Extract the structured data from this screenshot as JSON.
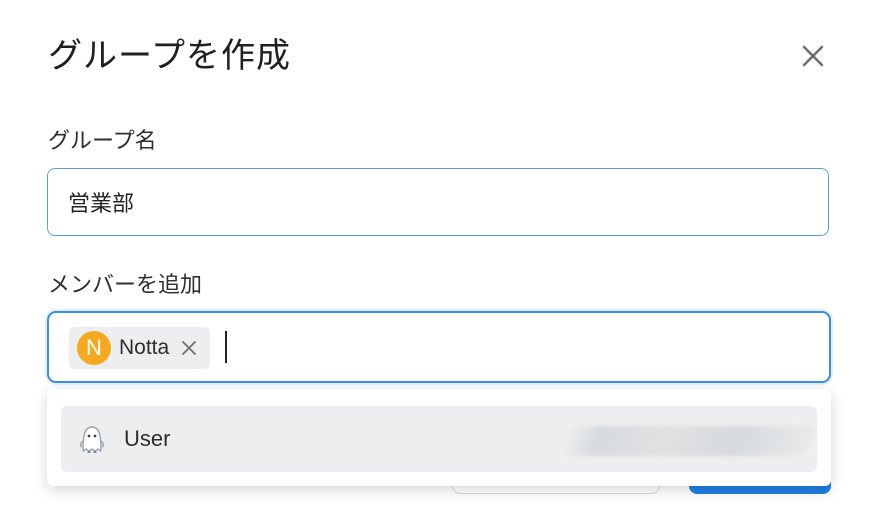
{
  "dialog": {
    "title": "グループを作成",
    "close_icon": "close-icon"
  },
  "group_name": {
    "label": "グループ名",
    "value": "営業部"
  },
  "members": {
    "label": "メンバーを追加",
    "chips": [
      {
        "initial": "N",
        "label": "Notta",
        "avatar_color": "#f4a91f"
      }
    ],
    "input_value": ""
  },
  "dropdown": {
    "options": [
      {
        "label": "User",
        "icon": "ghost-avatar-icon"
      }
    ]
  },
  "colors": {
    "accent": "#3b8fe0",
    "primary_button": "#1f7fe6",
    "chip_background": "#eceeef"
  }
}
